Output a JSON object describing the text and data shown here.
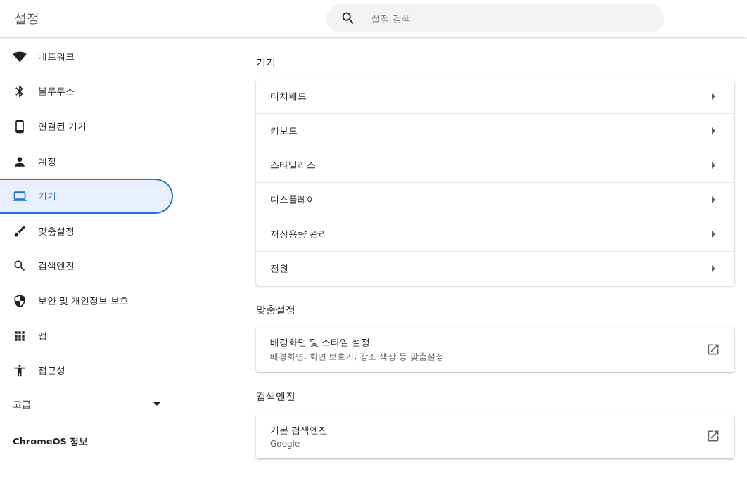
{
  "header": {
    "title": "설정",
    "search": {
      "placeholder": "설정 검색"
    }
  },
  "sidebar": {
    "items": [
      {
        "label": "네트워크",
        "selected": false
      },
      {
        "label": "블루투스",
        "selected": false
      },
      {
        "label": "연결된 기기",
        "selected": false
      },
      {
        "label": "계정",
        "selected": false
      },
      {
        "label": "기기",
        "selected": true
      },
      {
        "label": "맞춤설정",
        "selected": false
      },
      {
        "label": "검색엔진",
        "selected": false
      },
      {
        "label": "보안 및 개인정보 보호",
        "selected": false
      },
      {
        "label": "앱",
        "selected": false
      },
      {
        "label": "접근성",
        "selected": false
      }
    ],
    "advanced": {
      "label": "고급",
      "expanded": false
    },
    "about": {
      "label": "ChromeOS 정보"
    }
  },
  "sections": [
    {
      "title": "기기",
      "rows": [
        {
          "kind": "submenu",
          "label": "터치패드"
        },
        {
          "kind": "submenu",
          "label": "키보드"
        },
        {
          "kind": "submenu",
          "label": "스타일러스"
        },
        {
          "kind": "submenu",
          "label": "디스플레이"
        },
        {
          "kind": "submenu",
          "label": "저장용량 관리"
        },
        {
          "kind": "submenu",
          "label": "전원"
        }
      ]
    },
    {
      "title": "맞춤설정",
      "rows": [
        {
          "kind": "external",
          "label": "배경화면 및 스타일 설정",
          "subtitle": "배경화면, 화면 보호기, 강조 색상 등 맞춤설정"
        }
      ]
    },
    {
      "title": "검색엔진",
      "rows": [
        {
          "kind": "external",
          "label": "기본 검색엔진",
          "subtitle": "Google"
        }
      ]
    }
  ]
}
